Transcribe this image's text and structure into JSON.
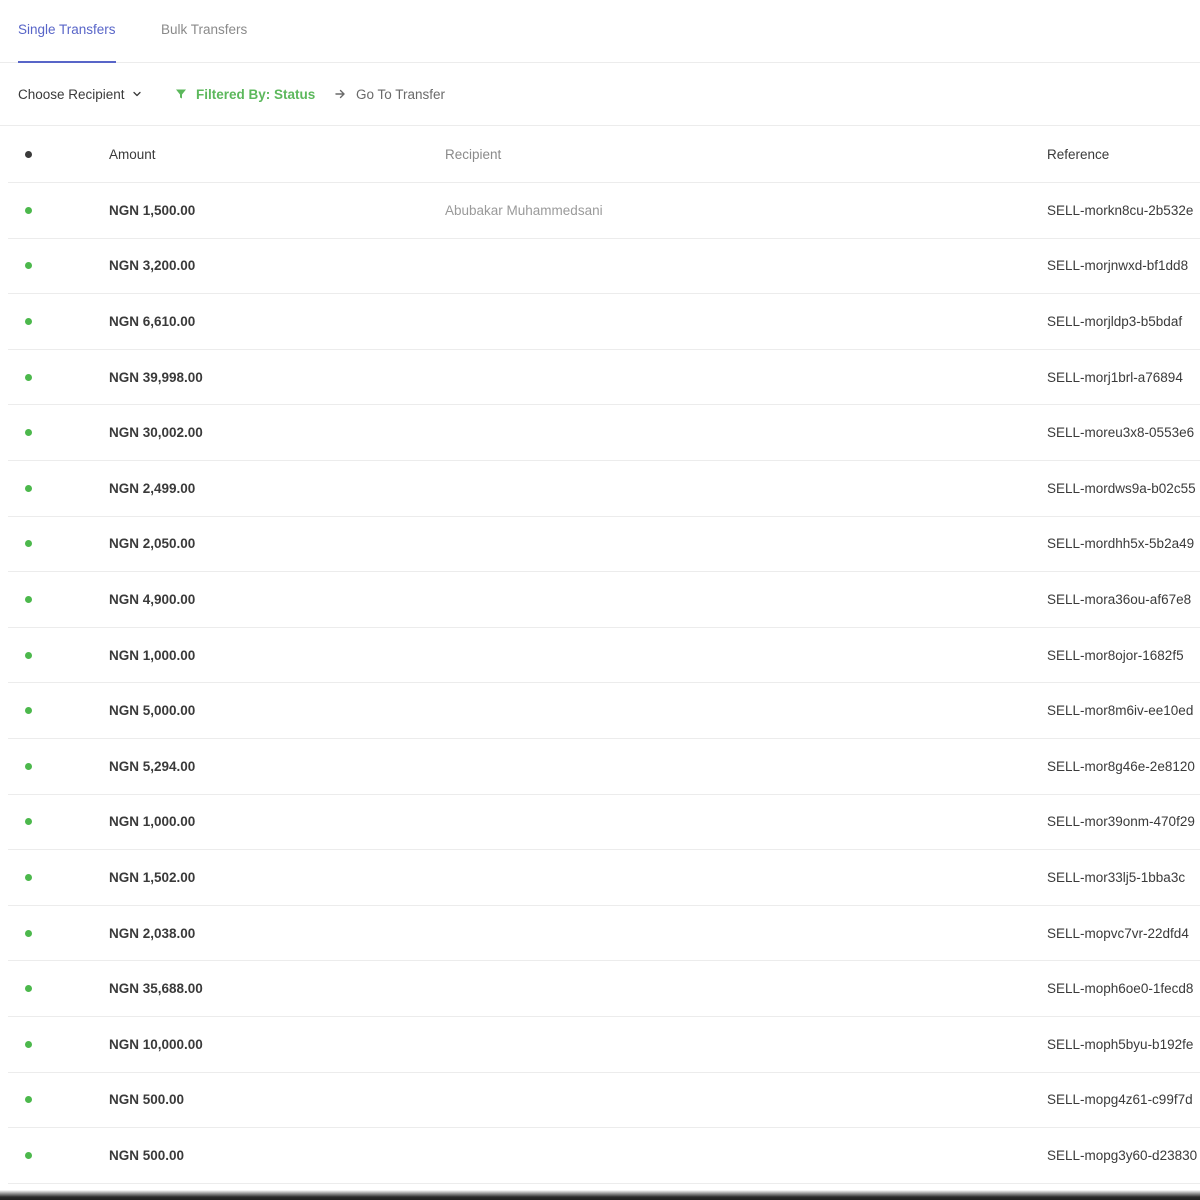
{
  "tabs": [
    {
      "label": "Single Transfers",
      "active": true
    },
    {
      "label": "Bulk Transfers",
      "active": false
    }
  ],
  "toolbar": {
    "choose_recipient_label": "Choose Recipient",
    "filter_label": "Filtered By: Status",
    "goto_label": "Go To Transfer",
    "icons": {
      "choose_recipient": "chevron-down-icon",
      "filter": "filter-icon",
      "goto": "arrow-right-icon"
    }
  },
  "colors": {
    "accent": "#5865c8",
    "status_success": "#4cb84c",
    "filter_text": "#5cb85c"
  },
  "table": {
    "columns": {
      "status": "",
      "amount": "Amount",
      "recipient": "Recipient",
      "reference": "Reference"
    },
    "rows": [
      {
        "status": "success",
        "amount": "NGN 1,500.00",
        "recipient": "Abubakar Muhammedsani",
        "recipient_blurred": false,
        "reference": "SELL-morkn8cu-2b532e"
      },
      {
        "status": "success",
        "amount": "NGN 3,200.00",
        "recipient": "",
        "recipient_blurred": true,
        "reference": "SELL-morjnwxd-bf1dd8"
      },
      {
        "status": "success",
        "amount": "NGN 6,610.00",
        "recipient": "",
        "recipient_blurred": true,
        "reference": "SELL-morjldp3-b5bdaf"
      },
      {
        "status": "success",
        "amount": "NGN 39,998.00",
        "recipient": "",
        "recipient_blurred": true,
        "reference": "SELL-morj1brl-a76894"
      },
      {
        "status": "success",
        "amount": "NGN 30,002.00",
        "recipient": "",
        "recipient_blurred": true,
        "reference": "SELL-moreu3x8-0553e6"
      },
      {
        "status": "success",
        "amount": "NGN 2,499.00",
        "recipient": "",
        "recipient_blurred": true,
        "reference": "SELL-mordws9a-b02c55"
      },
      {
        "status": "success",
        "amount": "NGN 2,050.00",
        "recipient": "",
        "recipient_blurred": true,
        "reference": "SELL-mordhh5x-5b2a49"
      },
      {
        "status": "success",
        "amount": "NGN 4,900.00",
        "recipient": "",
        "recipient_blurred": true,
        "reference": "SELL-mora36ou-af67e8"
      },
      {
        "status": "success",
        "amount": "NGN 1,000.00",
        "recipient": "",
        "recipient_blurred": true,
        "reference": "SELL-mor8ojor-1682f5"
      },
      {
        "status": "success",
        "amount": "NGN 5,000.00",
        "recipient": "",
        "recipient_blurred": true,
        "reference": "SELL-mor8m6iv-ee10ed"
      },
      {
        "status": "success",
        "amount": "NGN 5,294.00",
        "recipient": "",
        "recipient_blurred": true,
        "reference": "SELL-mor8g46e-2e8120"
      },
      {
        "status": "success",
        "amount": "NGN 1,000.00",
        "recipient": "",
        "recipient_blurred": true,
        "reference": "SELL-mor39onm-470f29"
      },
      {
        "status": "success",
        "amount": "NGN 1,502.00",
        "recipient": "",
        "recipient_blurred": true,
        "reference": "SELL-mor33lj5-1bba3c"
      },
      {
        "status": "success",
        "amount": "NGN 2,038.00",
        "recipient": "",
        "recipient_blurred": true,
        "reference": "SELL-mopvc7vr-22dfd4"
      },
      {
        "status": "success",
        "amount": "NGN 35,688.00",
        "recipient": "",
        "recipient_blurred": true,
        "reference": "SELL-moph6oe0-1fecd8"
      },
      {
        "status": "success",
        "amount": "NGN 10,000.00",
        "recipient": "",
        "recipient_blurred": true,
        "reference": "SELL-moph5byu-b192fe"
      },
      {
        "status": "success",
        "amount": "NGN 500.00",
        "recipient": "",
        "recipient_blurred": true,
        "reference": "SELL-mopg4z61-c99f7d"
      },
      {
        "status": "success",
        "amount": "NGN 500.00",
        "recipient": "",
        "recipient_blurred": true,
        "reference": "SELL-mopg3y60-d23830"
      }
    ]
  }
}
